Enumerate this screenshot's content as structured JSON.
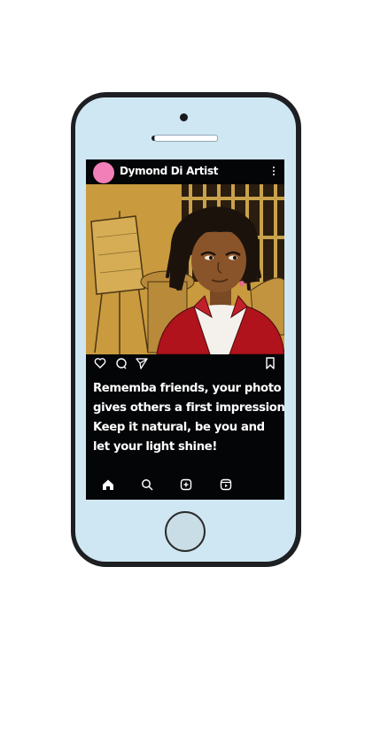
{
  "post": {
    "username": "Dymond Di Artist",
    "caption_lines": [
      "Rememba friends, your photo",
      "gives others a first impression",
      "Keep it natural, be you and",
      "let your light shine!"
    ]
  },
  "icons": {
    "header": "more-icon",
    "actions": [
      "heart-icon",
      "comment-icon",
      "share-icon",
      "bookmark-icon"
    ],
    "tabs": [
      "home-icon",
      "search-icon",
      "create-icon",
      "reels-icon"
    ]
  },
  "colors": {
    "phone_body": "#1d1f22",
    "phone_face": "#cfe7f3",
    "screen_bg": "#040507",
    "avatar": "#f27fb8",
    "photo_bg": "#caa04a",
    "jacket": "#b0131c"
  }
}
